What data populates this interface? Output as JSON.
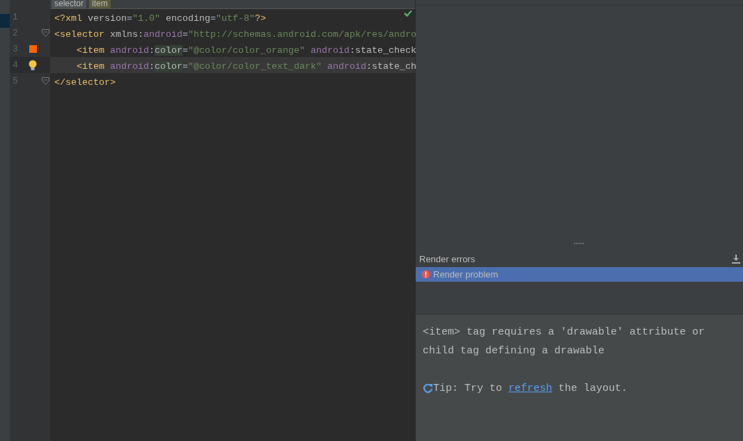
{
  "breadcrumbs": [
    {
      "label": "selector",
      "selected": false
    },
    {
      "label": "item",
      "selected": true
    }
  ],
  "editor": {
    "lines": [
      {
        "number": "1",
        "current": false,
        "fold": false,
        "bulb": false,
        "tokens": [
          {
            "kind": "tag",
            "text": "<?xml "
          },
          {
            "kind": "attr",
            "text": "version"
          },
          {
            "kind": "plain",
            "text": "="
          },
          {
            "kind": "string",
            "text": "\"1.0\""
          },
          {
            "kind": "attr",
            "text": " encoding"
          },
          {
            "kind": "plain",
            "text": "="
          },
          {
            "kind": "string",
            "text": "\"utf-8\""
          },
          {
            "kind": "tag",
            "text": "?>"
          }
        ]
      },
      {
        "number": "2",
        "current": false,
        "fold": true,
        "bulb": false,
        "tokens": [
          {
            "kind": "tag",
            "text": "<selector"
          },
          {
            "kind": "attr",
            "text": " xmlns"
          },
          {
            "kind": "plain",
            "text": ":"
          },
          {
            "kind": "ns",
            "text": "android"
          },
          {
            "kind": "plain",
            "text": "="
          },
          {
            "kind": "string",
            "text": "\"http://schemas.android.com/apk/res/andro"
          }
        ]
      },
      {
        "number": "3",
        "current": false,
        "fold": false,
        "bulb": false,
        "indent": true,
        "color": "#ff6600",
        "tokens": [
          {
            "kind": "tag",
            "text": "<item "
          },
          {
            "kind": "ns",
            "text": "android"
          },
          {
            "kind": "plain",
            "text": ":"
          },
          {
            "kind": "attr",
            "text": "color",
            "highlight": true
          },
          {
            "kind": "plain",
            "text": "="
          },
          {
            "kind": "string",
            "text": "\"@color/color_orange\" "
          },
          {
            "kind": "ns",
            "text": "android"
          },
          {
            "kind": "attr",
            "text": ":state_check"
          }
        ]
      },
      {
        "number": "4",
        "current": true,
        "fold": false,
        "bulb": true,
        "indent": true,
        "tokens": [
          {
            "kind": "tag",
            "text": "<item "
          },
          {
            "kind": "ns",
            "text": "android"
          },
          {
            "kind": "plain",
            "text": ":"
          },
          {
            "kind": "attr",
            "text": "color",
            "highlight": true
          },
          {
            "kind": "plain",
            "text": "="
          },
          {
            "kind": "string",
            "text": "\"@color/color_text_dark\" "
          },
          {
            "kind": "ns",
            "text": "android"
          },
          {
            "kind": "attr",
            "text": ":state_ch"
          }
        ]
      },
      {
        "number": "5",
        "current": false,
        "fold": true,
        "bulb": false,
        "tokens": [
          {
            "kind": "tag",
            "text": "</selector>"
          }
        ]
      }
    ]
  },
  "render_errors": {
    "title": "Render errors",
    "items": [
      {
        "label": "Render problem",
        "selected": true
      }
    ],
    "message": "<item> tag requires a 'drawable' attribute or child tag defining a drawable",
    "tip": {
      "before": "Tip: Try to ",
      "link": "refresh",
      "after": " the layout."
    }
  }
}
